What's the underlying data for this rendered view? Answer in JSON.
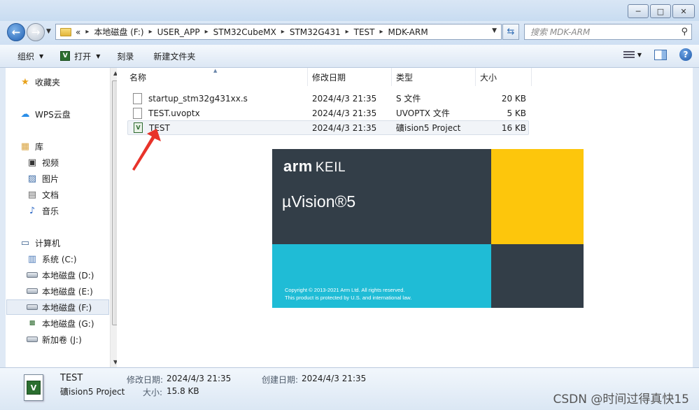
{
  "window": {
    "buttons": {
      "minimize": "─",
      "maximize": "□",
      "close": "✕"
    }
  },
  "address": {
    "breadcrumb_prefix": "«",
    "crumbs": [
      "本地磁盘 (F:)",
      "USER_APP",
      "STM32CubeMX",
      "STM32G431",
      "TEST",
      "MDK-ARM"
    ],
    "search_placeholder": "搜索 MDK-ARM"
  },
  "toolbar": {
    "organize": "组织",
    "open": "打开",
    "burn": "刻录",
    "new_folder": "新建文件夹"
  },
  "nav": {
    "favorites": "收藏夹",
    "wps": "WPS云盘",
    "library": "库",
    "library_items": [
      "视频",
      "图片",
      "文档",
      "音乐"
    ],
    "computer": "计算机",
    "drives": [
      "系统 (C:)",
      "本地磁盘 (D:)",
      "本地磁盘 (E:)",
      "本地磁盘 (F:)",
      "本地磁盘 (G:)",
      "新加卷 (J:)"
    ]
  },
  "columns": {
    "name": "名称",
    "modified": "修改日期",
    "type": "类型",
    "size": "大小"
  },
  "files": [
    {
      "name": "startup_stm32g431xx.s",
      "modified": "2024/4/3 21:35",
      "type": "S 文件",
      "size": "20 KB"
    },
    {
      "name": "TEST.uvoptx",
      "modified": "2024/4/3 21:35",
      "type": "UVOPTX 文件",
      "size": "5 KB"
    },
    {
      "name": "TEST",
      "modified": "2024/4/3 21:35",
      "type": "礦ision5 Project",
      "size": "16 KB"
    }
  ],
  "splash": {
    "brand": "arm",
    "brand2": "KEIL",
    "product": "µVision®5",
    "copyright1": "Copyright © 2013-2021 Arm Ltd. All rights reserved.",
    "copyright2": "This product is protected by U.S. and international law."
  },
  "details": {
    "name": "TEST",
    "type": "礦ision5 Project",
    "modified_label": "修改日期:",
    "modified_value": "2024/4/3 21:35",
    "created_label": "创建日期:",
    "created_value": "2024/4/3 21:35",
    "size_label": "大小:",
    "size_value": "15.8 KB"
  },
  "watermark": "CSDN @时间过得真快15",
  "colors": {
    "keil_dark": "#333e48",
    "keil_yellow": "#fdc60c",
    "keil_cyan": "#1fbcd6",
    "arrow_red": "#e8332a"
  }
}
